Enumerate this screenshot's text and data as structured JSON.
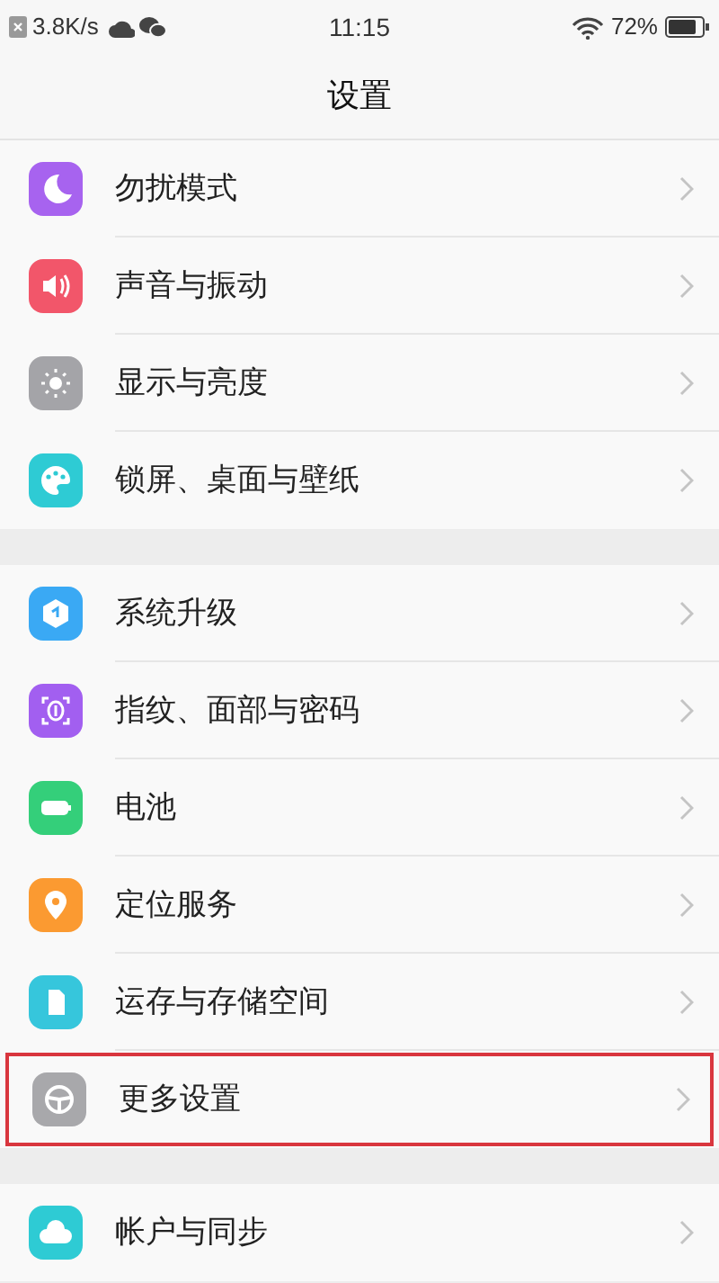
{
  "status_bar": {
    "speed": "3.8K/s",
    "time": "11:15",
    "battery": "72%"
  },
  "title": "设置",
  "groups": [
    {
      "items": [
        {
          "label": "勿扰模式",
          "color": "#a763ef",
          "highlighted": false
        },
        {
          "label": "声音与振动",
          "color": "#f2566a",
          "highlighted": false
        },
        {
          "label": "显示与亮度",
          "color": "#a4a4a8",
          "highlighted": false
        },
        {
          "label": "锁屏、桌面与壁纸",
          "color": "#2ecbd4",
          "highlighted": false
        }
      ]
    },
    {
      "items": [
        {
          "label": "系统升级",
          "color": "#3aa9f4",
          "highlighted": false
        },
        {
          "label": "指纹、面部与密码",
          "color": "#a25ff0",
          "highlighted": false
        },
        {
          "label": "电池",
          "color": "#34cf7a",
          "highlighted": false
        },
        {
          "label": "定位服务",
          "color": "#fb9a31",
          "highlighted": false
        },
        {
          "label": "运存与存储空间",
          "color": "#36c6dc",
          "highlighted": false
        },
        {
          "label": "更多设置",
          "color": "#a8a8ab",
          "highlighted": true
        }
      ]
    },
    {
      "items": [
        {
          "label": "帐户与同步",
          "color": "#2ecbd4",
          "highlighted": false
        }
      ]
    }
  ]
}
